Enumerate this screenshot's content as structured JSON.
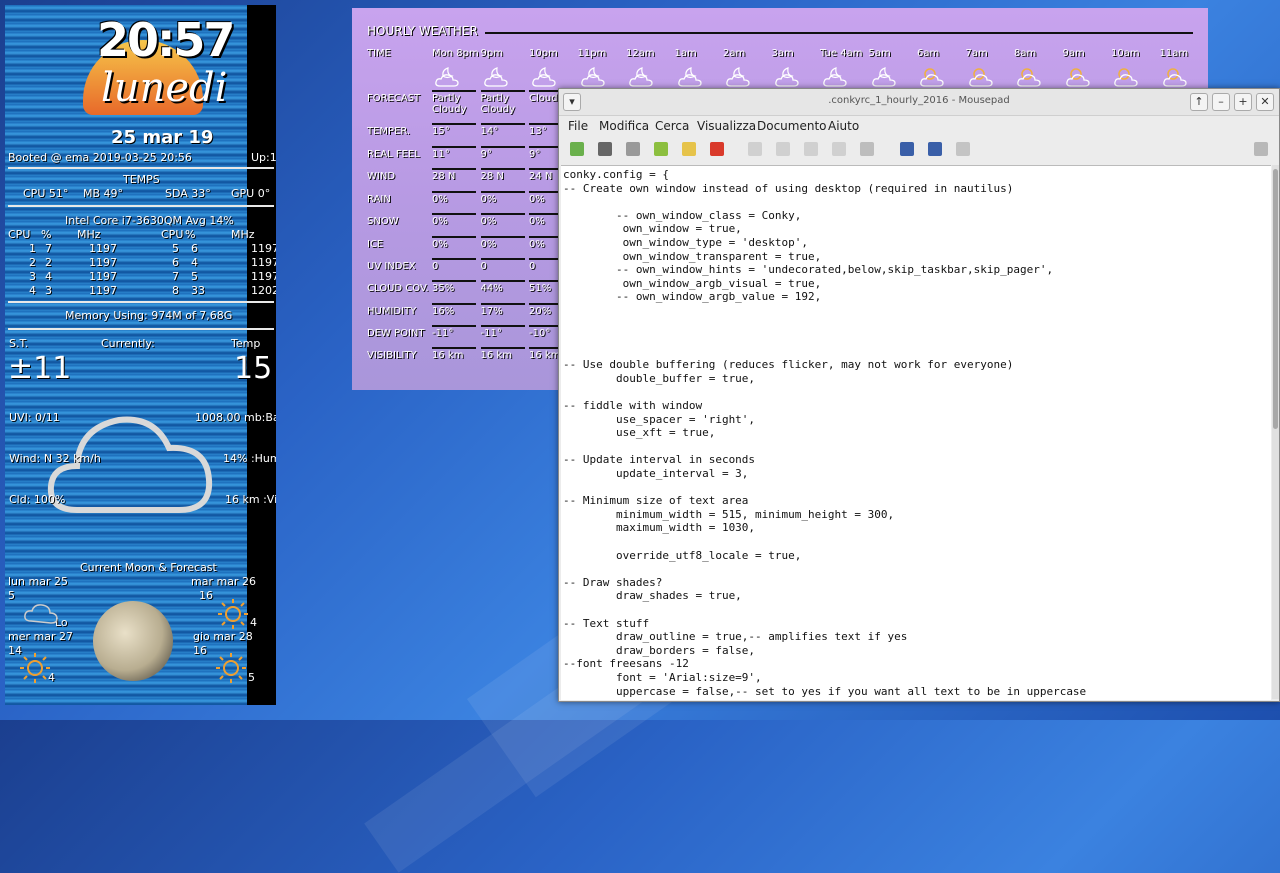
{
  "conky": {
    "time": "20:57",
    "day": "lunedi",
    "date": "25 mar 19",
    "booted": "Booted @ ema 2019-03-25 20:56",
    "uptime": "Up:1",
    "temps_title": "TEMPS",
    "temps": [
      "CPU 51°",
      "MB 49°",
      "SDA 33°",
      "GPU 0°"
    ],
    "cpu_title": "Intel Core i7-3630QM Avg 14%",
    "cpu_headers": [
      "CPU",
      "%",
      "MHz",
      "CPU",
      "%",
      "MHz"
    ],
    "cpu_rows": [
      [
        "1",
        "7",
        "1197",
        "5",
        "6",
        "1197"
      ],
      [
        "2",
        "2",
        "1197",
        "6",
        "4",
        "1197"
      ],
      [
        "3",
        "4",
        "1197",
        "7",
        "5",
        "1197"
      ],
      [
        "4",
        "3",
        "1197",
        "8",
        "33",
        "1202"
      ]
    ],
    "memory": "Memory  Using: 974M of 7,68G",
    "st_label": "S.T.",
    "currently_label": "Currently:",
    "temp_label": "Temp",
    "st_value": "±11",
    "temp_value": "15",
    "uvi": "UVI: 0/11",
    "pressure": "1008.00 mb:Bar",
    "wind": "Wind: N 32 km/h",
    "humidity": "14% :Hum",
    "cloud": "Cld: 100%",
    "visibility": "16 km :Vis",
    "moon_title": "Current Moon & Forecast",
    "forecast": [
      {
        "date": "lun mar 25",
        "num": "5"
      },
      {
        "date": "mar mar 26",
        "num": "16"
      },
      {
        "date": "mer mar 27",
        "num": "14"
      },
      {
        "date": "gio mar 28",
        "num": "16"
      }
    ],
    "moon_side_label": "Lo",
    "side_nums": [
      "4",
      "4",
      "5"
    ]
  },
  "hourly": {
    "title": "HOURLY WEATHER",
    "time_label": "TIME",
    "hours": [
      "Mon 8pm",
      "9pm",
      "10pm",
      "11pm",
      "12am",
      "1am",
      "2am",
      "3am",
      "Tue 4am",
      "5am",
      "6am",
      "7am",
      "8am",
      "9am",
      "10am",
      "11am"
    ],
    "rows": [
      {
        "label": "FORECAST",
        "values": [
          "Partly Cloudy",
          "Partly Cloudy",
          "Cloudy"
        ]
      },
      {
        "label": "TEMPER.",
        "values": [
          "15°",
          "14°",
          "13°"
        ]
      },
      {
        "label": "REAL FEEL",
        "values": [
          "11°",
          "9°",
          "9°"
        ]
      },
      {
        "label": "WIND",
        "values": [
          "28 N",
          "28 N",
          "24 N"
        ]
      },
      {
        "label": "RAIN",
        "values": [
          "0%",
          "0%",
          "0%"
        ]
      },
      {
        "label": "SNOW",
        "values": [
          "0%",
          "0%",
          "0%"
        ]
      },
      {
        "label": "ICE",
        "values": [
          "0%",
          "0%",
          "0%"
        ]
      },
      {
        "label": "UV INDEX",
        "values": [
          "0",
          "0",
          "0"
        ]
      },
      {
        "label": "CLOUD COV.",
        "values": [
          "35%",
          "44%",
          "51%"
        ]
      },
      {
        "label": "HUMIDITY",
        "values": [
          "16%",
          "17%",
          "20%"
        ]
      },
      {
        "label": "DEW POINT",
        "values": [
          "-11°",
          "-11°",
          "-10°"
        ]
      },
      {
        "label": "VISIBILITY",
        "values": [
          "16 km",
          "16 km",
          "16 km"
        ]
      }
    ]
  },
  "mousepad": {
    "title": ".conkyrc_1_hourly_2016 - Mousepad",
    "menu": [
      "File",
      "Modifica",
      "Cerca",
      "Visualizza",
      "Documento",
      "Aiuto"
    ],
    "code": "conky.config = {\n-- Create own window instead of using desktop (required in nautilus)\n\n        -- own_window_class = Conky,\n         own_window = true,\n         own_window_type = 'desktop',\n         own_window_transparent = true,\n        -- own_window_hints = 'undecorated,below,skip_taskbar,skip_pager',\n         own_window_argb_visual = true,\n        -- own_window_argb_value = 192,\n\n\n\n\n-- Use double buffering (reduces flicker, may not work for everyone)\n        double_buffer = true,\n\n-- fiddle with window\n        use_spacer = 'right',\n        use_xft = true,\n\n-- Update interval in seconds\n        update_interval = 3,\n\n-- Minimum size of text area\n        minimum_width = 515, minimum_height = 300,\n        maximum_width = 1030,\n\n        override_utf8_locale = true,\n\n-- Draw shades?\n        draw_shades = true,\n\n-- Text stuff\n        draw_outline = true,-- amplifies text if yes\n        draw_borders = false,\n--font freesans -12\n        font = 'Arial:size=9',\n        uppercase = false,-- set to yes if you want all text to be in uppercase"
  }
}
